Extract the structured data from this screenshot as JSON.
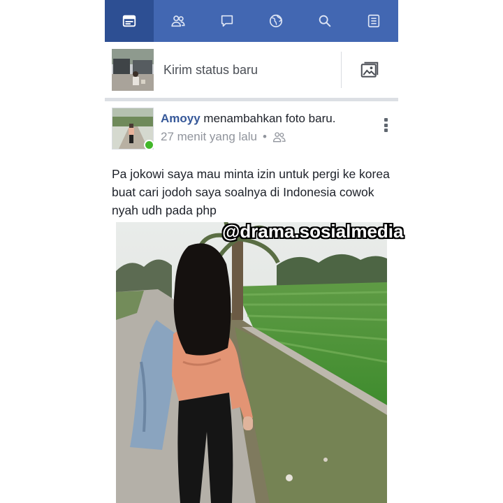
{
  "nav": {
    "items": [
      {
        "icon": "news-feed-icon",
        "active": true
      },
      {
        "icon": "friends-icon",
        "active": false
      },
      {
        "icon": "messages-icon",
        "active": false
      },
      {
        "icon": "globe-notifications-icon",
        "active": false
      },
      {
        "icon": "search-icon",
        "active": false
      },
      {
        "icon": "menu-list-icon",
        "active": false
      }
    ]
  },
  "composer": {
    "placeholder": "Kirim status baru",
    "photo_icon": "photo-icon"
  },
  "post": {
    "author": "Amoyy",
    "action": " menambahkan foto baru.",
    "time": "27 menit yang lalu",
    "separator": "•",
    "audience_icon": "friends-icon",
    "text": "Pa jokowi saya mau minta izin untuk pergi ke korea buat cari jodoh saya soalnya di Indonesia cowok nyah udh pada php",
    "photo_alt": "photo of a girl walking on a road beside rice fields"
  },
  "watermark": {
    "text": "@drama.sosialmedia"
  },
  "colors": {
    "brand": "#4267b2",
    "brand_active": "#2d4f93",
    "online": "#42b72a",
    "author": "#365899"
  }
}
